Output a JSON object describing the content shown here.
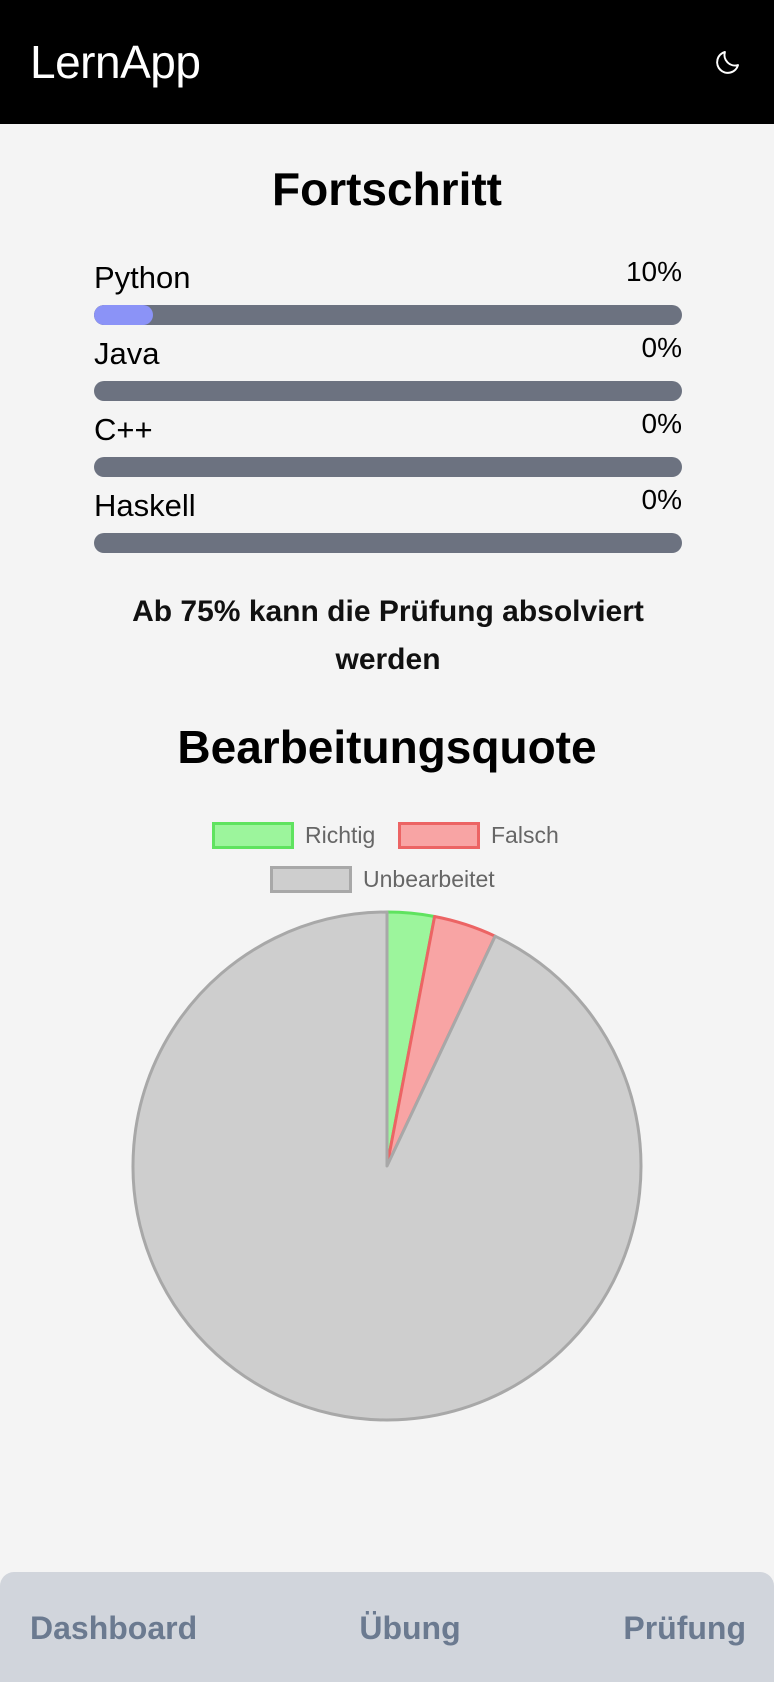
{
  "header": {
    "title": "LernApp",
    "theme_toggle_icon": "moon-icon"
  },
  "progress": {
    "title": "Fortschritt",
    "courses": [
      {
        "name": "Python",
        "percent_label": "10%",
        "value": 0.1
      },
      {
        "name": "Java",
        "percent_label": "0%",
        "value": 0
      },
      {
        "name": "C++",
        "percent_label": "0%",
        "value": 0
      },
      {
        "name": "Haskell",
        "percent_label": "0%",
        "value": 0
      }
    ],
    "exam_note": "Ab 75% kann die Prüfung absolviert werden"
  },
  "quote": {
    "title": "Bearbeitungsquote"
  },
  "chart_data": {
    "type": "pie",
    "legend_position": "top",
    "labels": [
      "Richtig",
      "Falsch",
      "Unbearbeitet"
    ],
    "values": [
      3,
      4,
      93
    ],
    "colors": {
      "Richtig": {
        "fill": "#9cf59c",
        "border": "#5fe35f"
      },
      "Falsch": {
        "fill": "#f8a4a4",
        "border": "#ec6464"
      },
      "Unbearbeitet": {
        "fill": "#cecece",
        "border": "#a8a8a8"
      }
    }
  },
  "nav": {
    "dashboard": "Dashboard",
    "uebung": "Übung",
    "pruefung": "Prüfung"
  },
  "colors": {
    "header_bg": "#000000",
    "progress_fill": "#8b93f7",
    "progress_track": "#6c7280",
    "nav_bg": "#d1d5dc",
    "nav_text": "#6b7a90"
  }
}
